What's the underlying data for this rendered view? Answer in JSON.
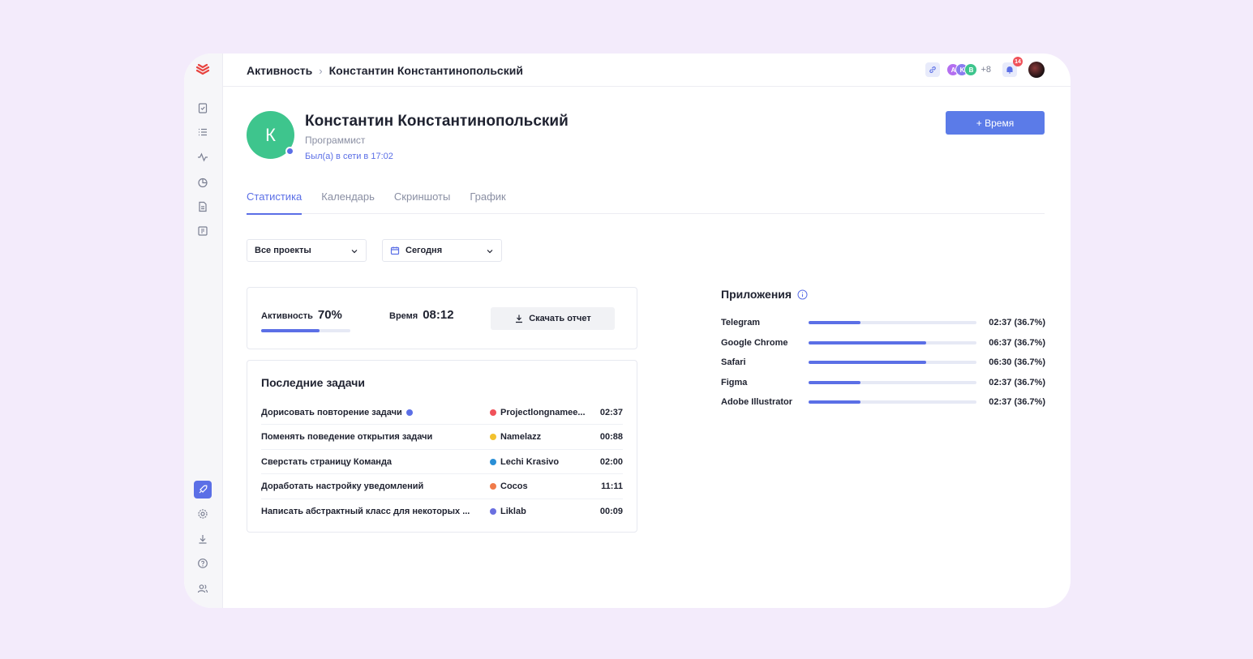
{
  "breadcrumb": {
    "root": "Активность",
    "current": "Константин Константинопольский"
  },
  "top": {
    "avatars": [
      "A",
      "K",
      "B"
    ],
    "more": "+8",
    "notifications": "14"
  },
  "profile": {
    "initial": "К",
    "name": "Константин Константинопольский",
    "role": "Программист",
    "last_seen": "Был(а) в сети в 17:02"
  },
  "add_time_label": "+ Время",
  "tabs": [
    "Статистика",
    "Календарь",
    "Скриншоты",
    "График"
  ],
  "filters": {
    "projects": "Все проекты",
    "period": "Сегодня"
  },
  "stats": {
    "activity_label": "Активность",
    "activity_value": "70%",
    "activity_fraction": 0.65,
    "time_label": "Время",
    "time_value": "08:12",
    "download_label": "Скачать отчет"
  },
  "tasks": {
    "title": "Последние задачи",
    "rows": [
      {
        "name": "Дорисовать повторение задачи",
        "flag": true,
        "project": "Projectlongnamee...",
        "color": "#f0525a",
        "time": "02:37"
      },
      {
        "name": "Поменять поведение открытия задачи",
        "flag": false,
        "project": "Namelazz",
        "color": "#f2c12e",
        "time": "00:88"
      },
      {
        "name": "Сверстать страницу Команда",
        "flag": false,
        "project": "Lechi Krasivo",
        "color": "#2a8fd6",
        "time": "02:00"
      },
      {
        "name": "Доработать настройку уведомлений",
        "flag": false,
        "project": "Cocos",
        "color": "#f07b4a",
        "time": "11:11"
      },
      {
        "name": "Написать абстрактный класс для некоторых ...",
        "flag": false,
        "project": "Liklab",
        "color": "#6a6fe0",
        "time": "00:09"
      }
    ]
  },
  "apps": {
    "title": "Приложения",
    "rows": [
      {
        "name": "Telegram",
        "fraction": 0.31,
        "time": "02:37 (36.7%)"
      },
      {
        "name": "Google Chrome",
        "fraction": 0.7,
        "time": "06:37 (36.7%)"
      },
      {
        "name": "Safari",
        "fraction": 0.7,
        "time": "06:30 (36.7%)"
      },
      {
        "name": "Figma",
        "fraction": 0.31,
        "time": "02:37 (36.7%)"
      },
      {
        "name": "Adobe Illustrator",
        "fraction": 0.31,
        "time": "02:37 (36.7%)"
      }
    ]
  },
  "colors": {
    "accent": "#5b6fe6",
    "avatar": "#3ec58d",
    "background": "#f3ebfb"
  }
}
